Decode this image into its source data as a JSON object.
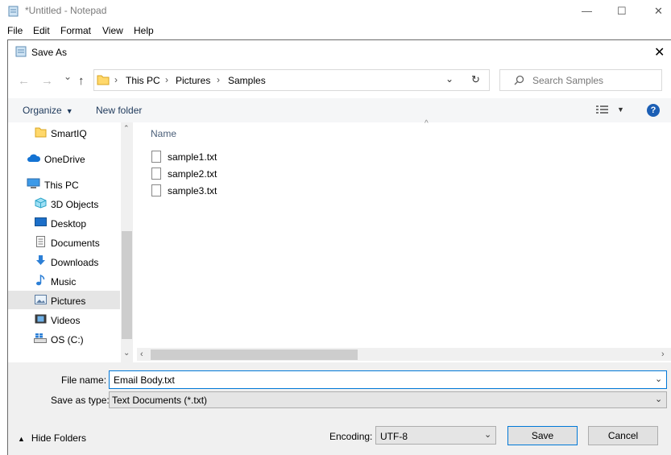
{
  "notepad": {
    "title": "*Untitled - Notepad",
    "menu": [
      "File",
      "Edit",
      "Format",
      "View",
      "Help"
    ],
    "controls": {
      "minimize": "—",
      "maximize": "☐",
      "close": "✕"
    }
  },
  "dialog": {
    "title": "Save As",
    "close": "✕",
    "nav": {
      "back": "←",
      "forward": "→",
      "history": "⌄",
      "up": "↑",
      "refresh": "↻",
      "address_dropdown": "⌄"
    },
    "breadcrumb": [
      "This PC",
      "Pictures",
      "Samples"
    ],
    "search_placeholder": "Search Samples",
    "toolbar": {
      "organize": "Organize",
      "new_folder": "New folder"
    },
    "help": "?",
    "nav_items": [
      {
        "label": "SmartIQ",
        "icon": "folder-icon"
      },
      {
        "label": "OneDrive",
        "icon": "cloud-icon"
      },
      {
        "label": "This PC",
        "icon": "computer-icon"
      },
      {
        "label": "3D Objects",
        "icon": "cube-icon"
      },
      {
        "label": "Desktop",
        "icon": "desktop-icon"
      },
      {
        "label": "Documents",
        "icon": "document-icon"
      },
      {
        "label": "Downloads",
        "icon": "download-icon"
      },
      {
        "label": "Music",
        "icon": "music-icon"
      },
      {
        "label": "Pictures",
        "icon": "picture-icon"
      },
      {
        "label": "Videos",
        "icon": "video-icon"
      },
      {
        "label": "OS (C:)",
        "icon": "drive-icon"
      }
    ],
    "column_header": "Name",
    "files": [
      "sample1.txt",
      "sample2.txt",
      "sample3.txt"
    ],
    "file_name_label": "File name:",
    "file_name_value": "Email Body.txt",
    "save_type_label": "Save as type:",
    "save_type_value": "Text Documents (*.txt)",
    "hide_folders": "Hide Folders",
    "encoding_label": "Encoding:",
    "encoding_value": "UTF-8",
    "save": "Save",
    "cancel": "Cancel"
  },
  "colors": {
    "accent": "#0078d7",
    "help": "#1c5fb5",
    "selected": "#e5e5e5"
  }
}
